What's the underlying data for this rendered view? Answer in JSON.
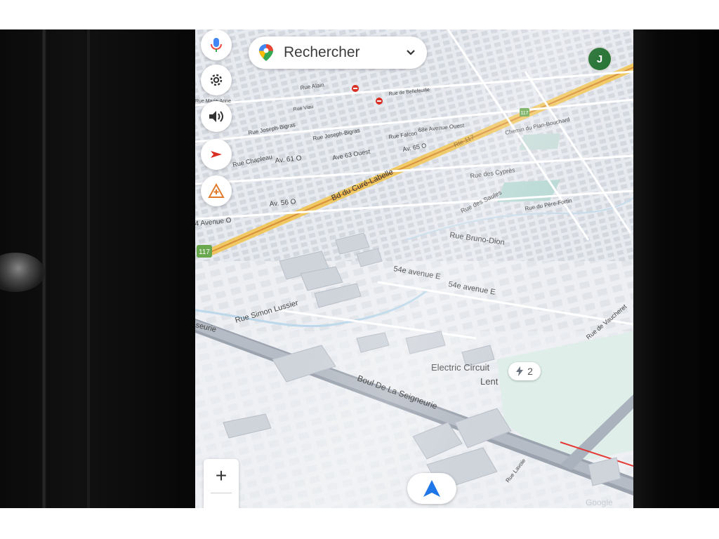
{
  "controls": {
    "mic_icon": "microphone-icon",
    "settings_icon": "gear-icon",
    "sound_icon": "speaker-icon",
    "route_icon": "navigation-arrow-icon",
    "report_icon": "report-hazard-icon"
  },
  "search": {
    "label": "Rechercher",
    "icon": "maps-pin-icon",
    "chevron": "chevron-down-icon"
  },
  "account": {
    "initial": "J"
  },
  "zoom": {
    "plus_label": "+"
  },
  "ev_charger": {
    "count": "2",
    "name": "Electric Circuit",
    "speed": "Lent"
  },
  "map_labels": {
    "rue_alain": "Rue Alain",
    "rue_bellefeuille": "Rue de Bellefeuille",
    "rue_marie": "Rue Marie-Anne",
    "rue_viau": "Rue Viau",
    "rue_joseph_bigras": "Rue Joseph-Bigras",
    "rue_joseph_bigras_2": "Rue Joseph-Bigras",
    "rue_falcon": "Rue Falcon",
    "av_68": "68e Avenue Ouest",
    "av_65": "Av. 65 O",
    "av_61": "Av. 61 O",
    "av_63": "Ave 63 Ouest",
    "rue_chapleau": "Rue Chapleau",
    "rte_117": "Rte 117",
    "shield_117a": "117",
    "shield_117b": "117",
    "chemin_plan": "Chemin du Plan-Bouchard",
    "rue_cypres": "Rue des Cyprès",
    "rue_saules": "Rue des Saules",
    "rue_pere": "Rue du Père-Fortin",
    "bd_cure": "Bd du Curé-Labelle",
    "av_56": "Av. 56 O",
    "avenue_o": "4 Avenue O",
    "rue_bruno": "Rue Bruno-Dion",
    "av_54e_1": "54e avenue E",
    "av_54e_2": "54e avenue E",
    "rue_simon": "Rue Simon Lussier",
    "seurie": "seurie",
    "boul_seigneurie": "Boul De La Seigneurie",
    "rue_vaucheret": "Rue de Vaucheret",
    "rue_right_bottom": "Rue Lavoie",
    "google": "Google"
  }
}
